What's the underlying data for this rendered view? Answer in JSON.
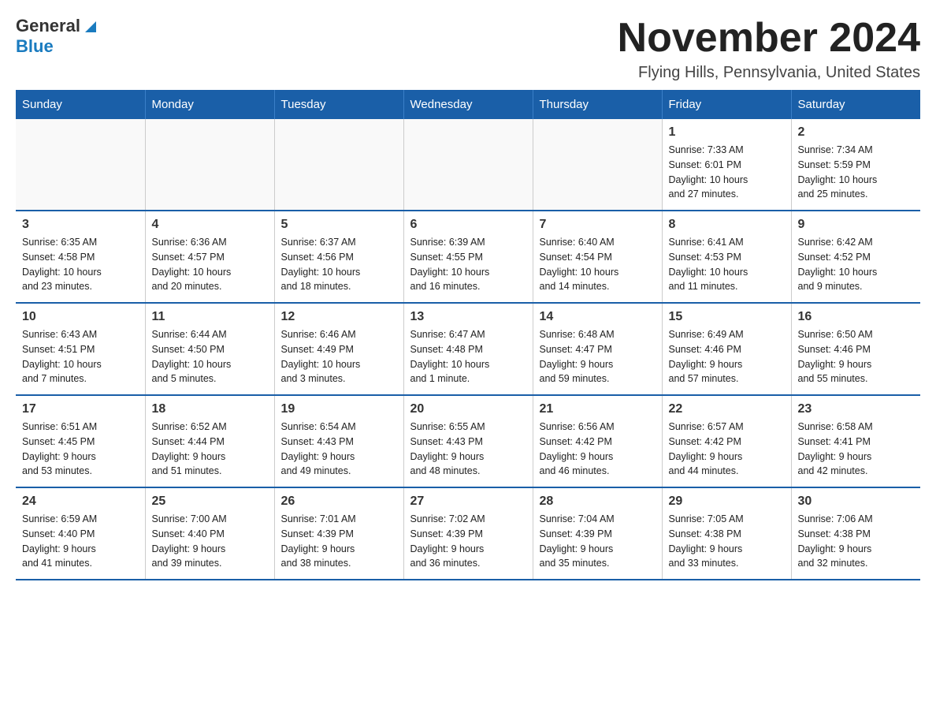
{
  "header": {
    "logo_text": "General",
    "logo_blue": "Blue",
    "month_title": "November 2024",
    "location": "Flying Hills, Pennsylvania, United States"
  },
  "days_of_week": [
    "Sunday",
    "Monday",
    "Tuesday",
    "Wednesday",
    "Thursday",
    "Friday",
    "Saturday"
  ],
  "weeks": [
    {
      "days": [
        {
          "num": "",
          "info": ""
        },
        {
          "num": "",
          "info": ""
        },
        {
          "num": "",
          "info": ""
        },
        {
          "num": "",
          "info": ""
        },
        {
          "num": "",
          "info": ""
        },
        {
          "num": "1",
          "info": "Sunrise: 7:33 AM\nSunset: 6:01 PM\nDaylight: 10 hours\nand 27 minutes."
        },
        {
          "num": "2",
          "info": "Sunrise: 7:34 AM\nSunset: 5:59 PM\nDaylight: 10 hours\nand 25 minutes."
        }
      ]
    },
    {
      "days": [
        {
          "num": "3",
          "info": "Sunrise: 6:35 AM\nSunset: 4:58 PM\nDaylight: 10 hours\nand 23 minutes."
        },
        {
          "num": "4",
          "info": "Sunrise: 6:36 AM\nSunset: 4:57 PM\nDaylight: 10 hours\nand 20 minutes."
        },
        {
          "num": "5",
          "info": "Sunrise: 6:37 AM\nSunset: 4:56 PM\nDaylight: 10 hours\nand 18 minutes."
        },
        {
          "num": "6",
          "info": "Sunrise: 6:39 AM\nSunset: 4:55 PM\nDaylight: 10 hours\nand 16 minutes."
        },
        {
          "num": "7",
          "info": "Sunrise: 6:40 AM\nSunset: 4:54 PM\nDaylight: 10 hours\nand 14 minutes."
        },
        {
          "num": "8",
          "info": "Sunrise: 6:41 AM\nSunset: 4:53 PM\nDaylight: 10 hours\nand 11 minutes."
        },
        {
          "num": "9",
          "info": "Sunrise: 6:42 AM\nSunset: 4:52 PM\nDaylight: 10 hours\nand 9 minutes."
        }
      ]
    },
    {
      "days": [
        {
          "num": "10",
          "info": "Sunrise: 6:43 AM\nSunset: 4:51 PM\nDaylight: 10 hours\nand 7 minutes."
        },
        {
          "num": "11",
          "info": "Sunrise: 6:44 AM\nSunset: 4:50 PM\nDaylight: 10 hours\nand 5 minutes."
        },
        {
          "num": "12",
          "info": "Sunrise: 6:46 AM\nSunset: 4:49 PM\nDaylight: 10 hours\nand 3 minutes."
        },
        {
          "num": "13",
          "info": "Sunrise: 6:47 AM\nSunset: 4:48 PM\nDaylight: 10 hours\nand 1 minute."
        },
        {
          "num": "14",
          "info": "Sunrise: 6:48 AM\nSunset: 4:47 PM\nDaylight: 9 hours\nand 59 minutes."
        },
        {
          "num": "15",
          "info": "Sunrise: 6:49 AM\nSunset: 4:46 PM\nDaylight: 9 hours\nand 57 minutes."
        },
        {
          "num": "16",
          "info": "Sunrise: 6:50 AM\nSunset: 4:46 PM\nDaylight: 9 hours\nand 55 minutes."
        }
      ]
    },
    {
      "days": [
        {
          "num": "17",
          "info": "Sunrise: 6:51 AM\nSunset: 4:45 PM\nDaylight: 9 hours\nand 53 minutes."
        },
        {
          "num": "18",
          "info": "Sunrise: 6:52 AM\nSunset: 4:44 PM\nDaylight: 9 hours\nand 51 minutes."
        },
        {
          "num": "19",
          "info": "Sunrise: 6:54 AM\nSunset: 4:43 PM\nDaylight: 9 hours\nand 49 minutes."
        },
        {
          "num": "20",
          "info": "Sunrise: 6:55 AM\nSunset: 4:43 PM\nDaylight: 9 hours\nand 48 minutes."
        },
        {
          "num": "21",
          "info": "Sunrise: 6:56 AM\nSunset: 4:42 PM\nDaylight: 9 hours\nand 46 minutes."
        },
        {
          "num": "22",
          "info": "Sunrise: 6:57 AM\nSunset: 4:42 PM\nDaylight: 9 hours\nand 44 minutes."
        },
        {
          "num": "23",
          "info": "Sunrise: 6:58 AM\nSunset: 4:41 PM\nDaylight: 9 hours\nand 42 minutes."
        }
      ]
    },
    {
      "days": [
        {
          "num": "24",
          "info": "Sunrise: 6:59 AM\nSunset: 4:40 PM\nDaylight: 9 hours\nand 41 minutes."
        },
        {
          "num": "25",
          "info": "Sunrise: 7:00 AM\nSunset: 4:40 PM\nDaylight: 9 hours\nand 39 minutes."
        },
        {
          "num": "26",
          "info": "Sunrise: 7:01 AM\nSunset: 4:39 PM\nDaylight: 9 hours\nand 38 minutes."
        },
        {
          "num": "27",
          "info": "Sunrise: 7:02 AM\nSunset: 4:39 PM\nDaylight: 9 hours\nand 36 minutes."
        },
        {
          "num": "28",
          "info": "Sunrise: 7:04 AM\nSunset: 4:39 PM\nDaylight: 9 hours\nand 35 minutes."
        },
        {
          "num": "29",
          "info": "Sunrise: 7:05 AM\nSunset: 4:38 PM\nDaylight: 9 hours\nand 33 minutes."
        },
        {
          "num": "30",
          "info": "Sunrise: 7:06 AM\nSunset: 4:38 PM\nDaylight: 9 hours\nand 32 minutes."
        }
      ]
    }
  ]
}
